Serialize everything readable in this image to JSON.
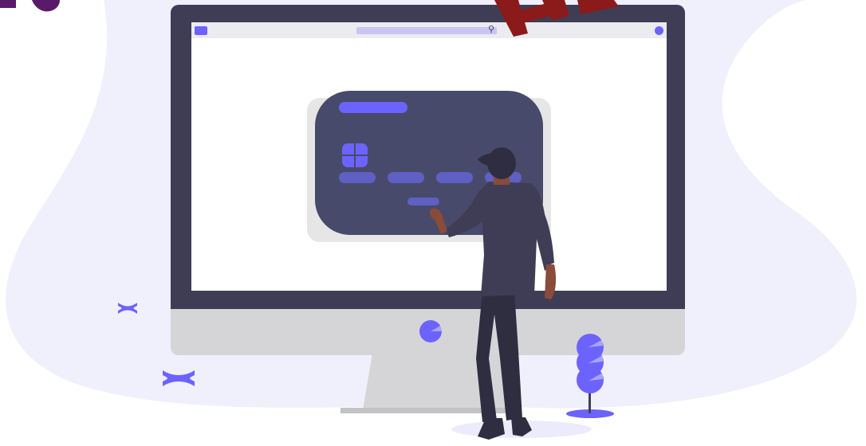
{
  "browser": {
    "menu_icon": "menu-icon",
    "search_icon": "search-icon",
    "search_glyph": "⚲",
    "avatar_icon": "user-avatar-icon"
  },
  "card": {
    "chip_icon": "card-chip-icon",
    "number_groups": 4
  },
  "decor": {
    "cross_glyph": "✕",
    "accent_color": "#6c63ff",
    "frame_color": "#3f3d56",
    "card_color": "#474a6a",
    "blob_color": "#f0effc",
    "logo_fragment_color": "#8b1a1a"
  }
}
